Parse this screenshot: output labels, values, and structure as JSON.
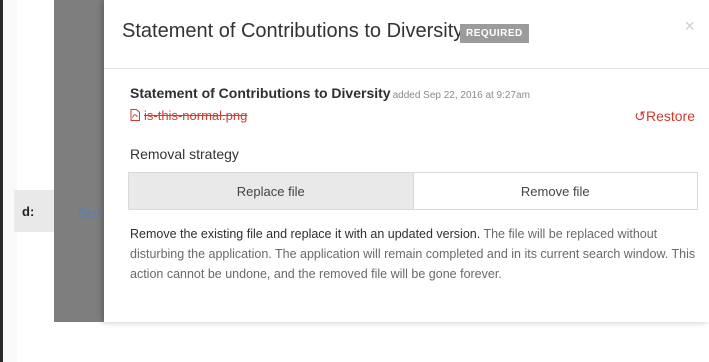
{
  "background": {
    "label": "d:",
    "link": "Sep"
  },
  "modal": {
    "title": "Statement of Contributions to Diversity",
    "badge": "REQUIRED",
    "close_icon": "close-icon",
    "field": {
      "title": "Statement of Contributions to Diversity",
      "meta": "added Sep 22, 2016 at 9:27am"
    },
    "file": {
      "name": "is-this-normal.png",
      "icon": "pdf-file-icon",
      "restore_label": "Restore"
    },
    "removal": {
      "label": "Removal strategy",
      "options": [
        "Replace file",
        "Remove file"
      ],
      "selected": "Replace file"
    },
    "description": {
      "lead": "Remove the existing file and replace it with an updated version.",
      "rest": " The file will be replaced without disturbing the application. The application will remain completed and in its current search window. This action cannot be undone, and the removed file will be gone forever."
    }
  },
  "colors": {
    "accent_red": "#d23a2f",
    "badge_gray": "#9b9b9b",
    "selected_segment": "#e9e9e9"
  }
}
